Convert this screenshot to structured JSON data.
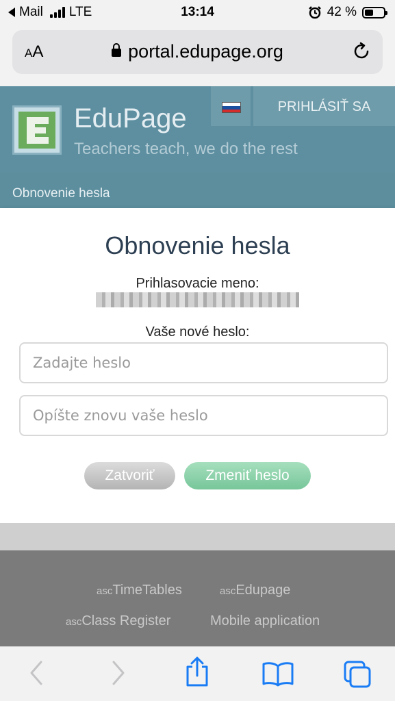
{
  "status_bar": {
    "back_app": "Mail",
    "carrier": "LTE",
    "time": "13:14",
    "battery": "42 %",
    "battery_level": 0.42
  },
  "browser": {
    "text_size_label_small": "A",
    "text_size_label_large": "A",
    "url": "portal.edupage.org"
  },
  "header": {
    "brand": "EduPage",
    "tagline": "Teachers teach, we do the rest",
    "login_label": "PRIHLÁSIŤ SA",
    "breadcrumb": "Obnovenie hesla"
  },
  "dialog": {
    "title": "Obnovenie hesla",
    "username_label": "Prihlasovacie meno:",
    "new_password_label": "Vaše nové heslo:",
    "password_placeholder": "Zadajte heslo",
    "password_repeat_placeholder": "Opíšte znovu vaše heslo",
    "close_button": "Zatvoriť",
    "change_button": "Zmeniť heslo"
  },
  "footer": {
    "links": [
      {
        "prefix": "asc",
        "label": "TimeTables"
      },
      {
        "prefix": "asc",
        "label": "Edupage"
      },
      {
        "prefix": "asc",
        "label": "Class Register"
      },
      {
        "prefix": "",
        "label": "Mobile application"
      }
    ]
  },
  "colors": {
    "header_bg": "#5d8fa0",
    "accent_green": "#77c69a",
    "ios_blue": "#1a7cf5"
  }
}
